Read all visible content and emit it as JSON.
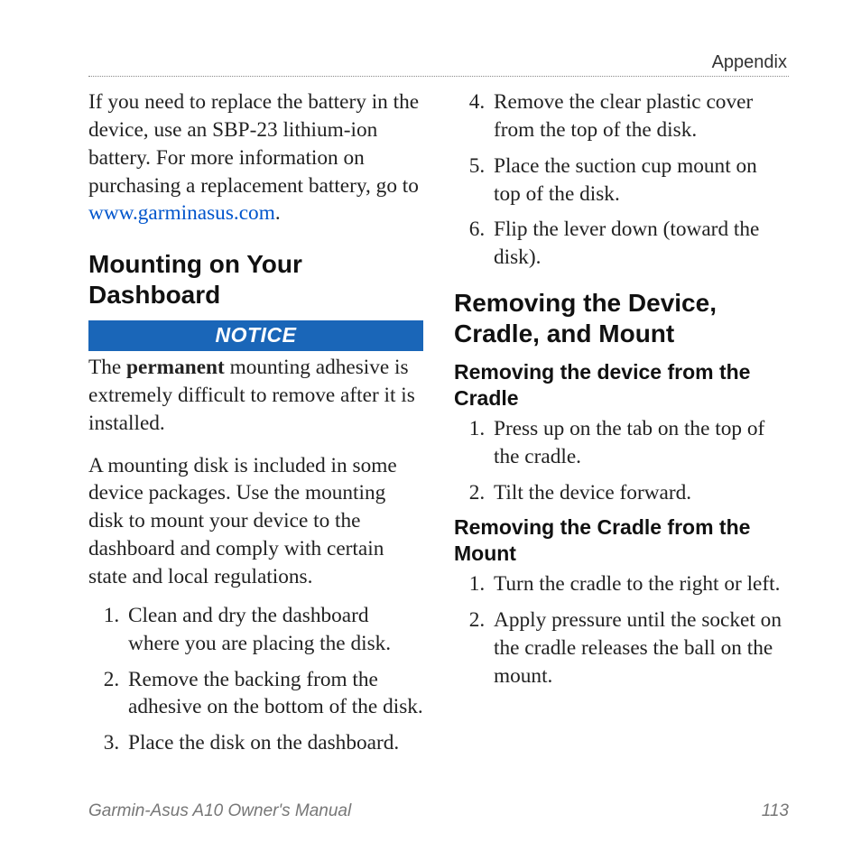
{
  "header": {
    "section": "Appendix"
  },
  "left": {
    "battery_para_pre": "If you need to replace the battery in the device, use an SBP-23 lithium-ion battery. For more information on purchasing a replacement battery, go to ",
    "battery_link": "www.garminasus.com",
    "battery_para_post": ".",
    "h2": "Mounting on Your Dashboard",
    "notice": "NOTICE",
    "notice_para_pre": "The ",
    "notice_para_bold": "permanent",
    "notice_para_post": " mounting adhesive is extremely difficult to remove after it is installed.",
    "disk_para": "A mounting disk is included in some device packages. Use the mounting disk to mount your device to the dashboard and comply with certain state and local regulations.",
    "steps": {
      "1": "Clean and dry the dashboard where you are placing the disk.",
      "2": "Remove the backing from the adhesive on the bottom of the disk.",
      "3": "Place the disk on the dashboard."
    }
  },
  "right": {
    "steps_cont": {
      "4": "Remove the clear plastic cover from the top of the disk.",
      "5": "Place the suction cup mount on top of the disk.",
      "6": "Flip the lever down (toward the disk)."
    },
    "h2": "Removing the Device, Cradle, and Mount",
    "sub1": "Removing the device from the Cradle",
    "sub1_steps": {
      "1": "Press up on the tab on the top of the cradle.",
      "2": "Tilt the device forward."
    },
    "sub2": "Removing the Cradle from the Mount",
    "sub2_steps": {
      "1": "Turn the cradle to the right or left.",
      "2": "Apply pressure until the socket on the cradle releases the ball on the mount."
    }
  },
  "footer": {
    "left": "Garmin-Asus A10 Owner's Manual",
    "right": "113"
  }
}
